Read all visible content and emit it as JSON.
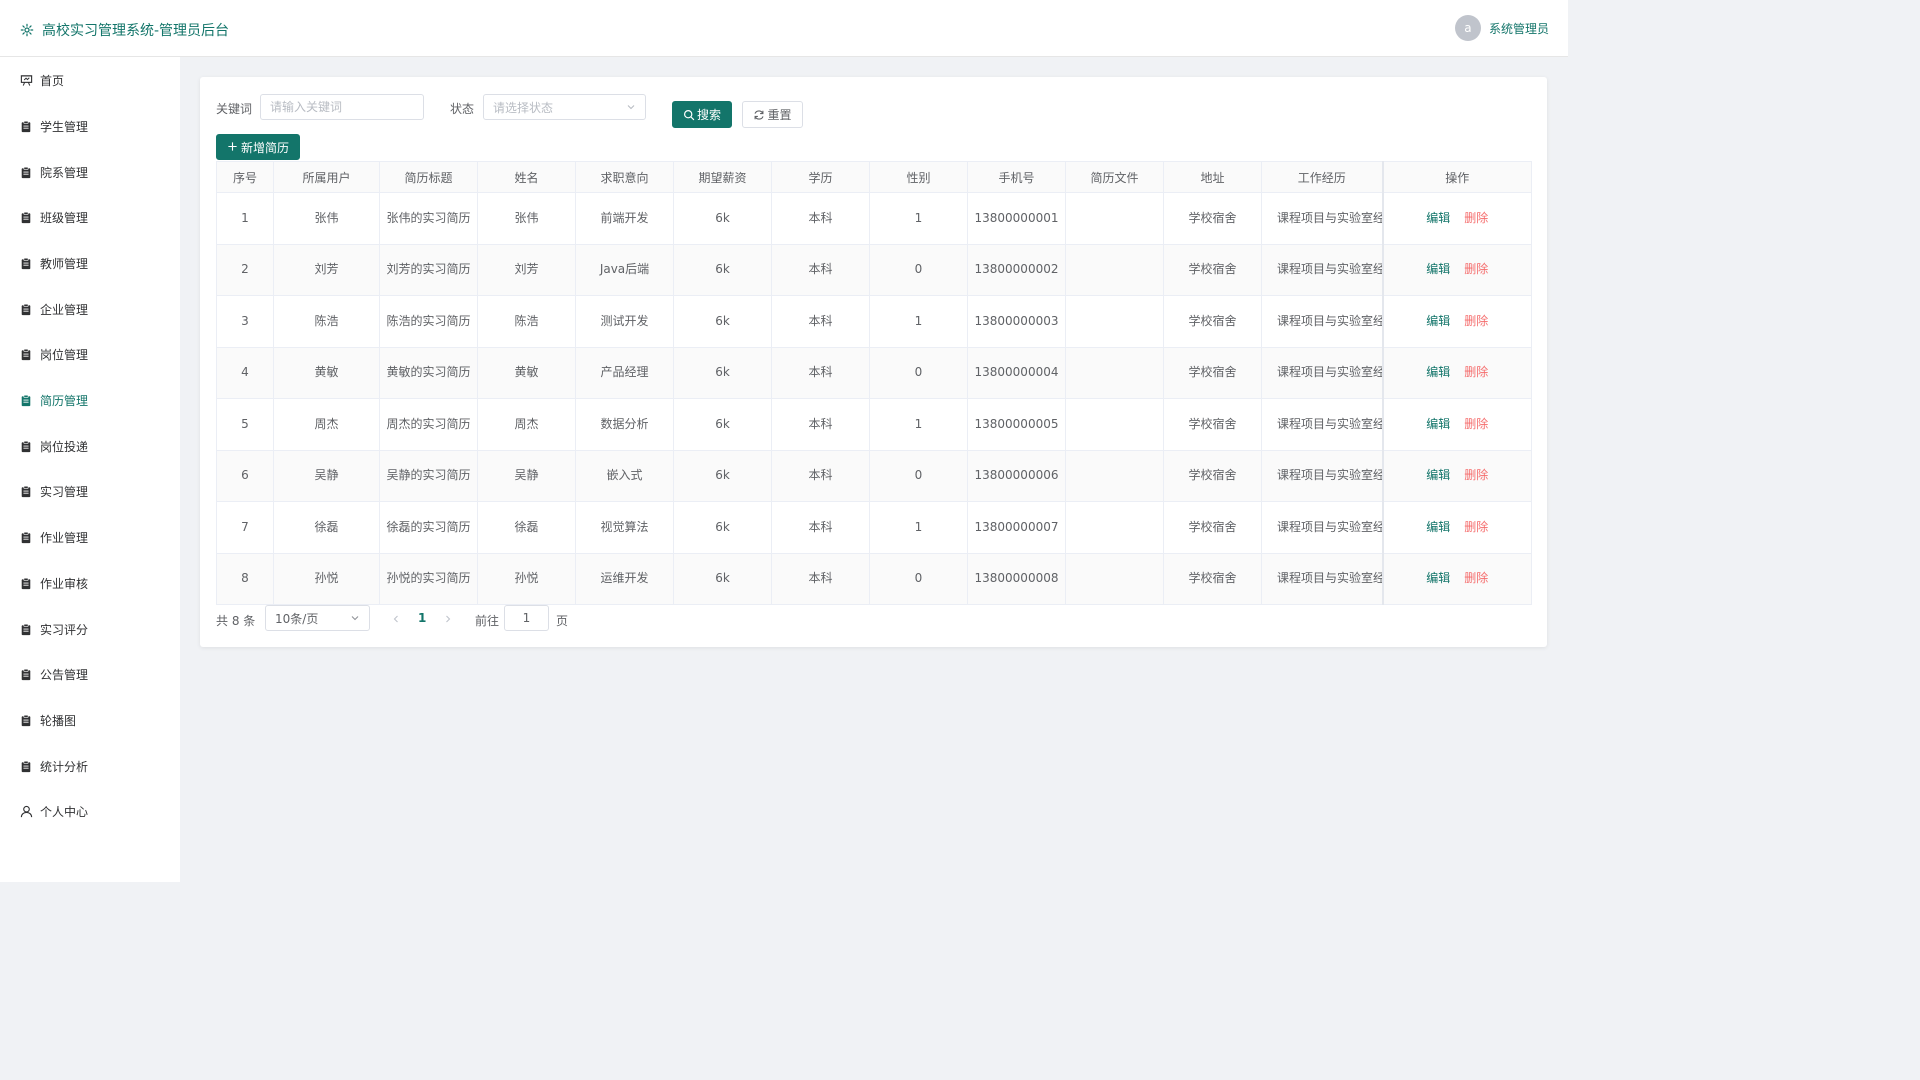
{
  "header": {
    "title": "高校实习管理系统-管理员后台",
    "avatar_letter": "a",
    "username": "系统管理员"
  },
  "sidebar": {
    "items": [
      {
        "label": "首页",
        "icon": "home-icon"
      },
      {
        "label": "学生管理",
        "icon": "clipboard-icon"
      },
      {
        "label": "院系管理",
        "icon": "clipboard-icon"
      },
      {
        "label": "班级管理",
        "icon": "clipboard-icon"
      },
      {
        "label": "教师管理",
        "icon": "clipboard-icon"
      },
      {
        "label": "企业管理",
        "icon": "clipboard-icon"
      },
      {
        "label": "岗位管理",
        "icon": "clipboard-icon"
      },
      {
        "label": "简历管理",
        "icon": "clipboard-icon",
        "active": true
      },
      {
        "label": "岗位投递",
        "icon": "clipboard-icon"
      },
      {
        "label": "实习管理",
        "icon": "clipboard-icon"
      },
      {
        "label": "作业管理",
        "icon": "clipboard-icon"
      },
      {
        "label": "作业审核",
        "icon": "clipboard-icon"
      },
      {
        "label": "实习评分",
        "icon": "clipboard-icon"
      },
      {
        "label": "公告管理",
        "icon": "clipboard-icon"
      },
      {
        "label": "轮播图",
        "icon": "clipboard-icon"
      },
      {
        "label": "统计分析",
        "icon": "clipboard-icon"
      },
      {
        "label": "个人中心",
        "icon": "user-icon"
      }
    ]
  },
  "filters": {
    "keyword_label": "关键词",
    "keyword_placeholder": "请输入关键词",
    "status_label": "状态",
    "status_placeholder": "请选择状态",
    "search_label": "搜索",
    "reset_label": "重置",
    "add_label": "新增简历"
  },
  "table": {
    "columns": [
      "序号",
      "所属用户",
      "简历标题",
      "姓名",
      "求职意向",
      "期望薪资",
      "学历",
      "性别",
      "手机号",
      "简历文件",
      "地址",
      "工作经历",
      "操作"
    ],
    "edit_label": "编辑",
    "delete_label": "删除",
    "rows": [
      {
        "no": "1",
        "user": "张伟",
        "title": "张伟的实习简历",
        "name": "张伟",
        "intent": "前端开发",
        "salary": "6k",
        "edu": "本科",
        "gender": "1",
        "phone": "13800000001",
        "file": "",
        "address": "学校宿舍",
        "experience": "课程项目与实验室经历"
      },
      {
        "no": "2",
        "user": "刘芳",
        "title": "刘芳的实习简历",
        "name": "刘芳",
        "intent": "Java后端",
        "salary": "6k",
        "edu": "本科",
        "gender": "0",
        "phone": "13800000002",
        "file": "",
        "address": "学校宿舍",
        "experience": "课程项目与实验室经历"
      },
      {
        "no": "3",
        "user": "陈浩",
        "title": "陈浩的实习简历",
        "name": "陈浩",
        "intent": "测试开发",
        "salary": "6k",
        "edu": "本科",
        "gender": "1",
        "phone": "13800000003",
        "file": "",
        "address": "学校宿舍",
        "experience": "课程项目与实验室经历"
      },
      {
        "no": "4",
        "user": "黄敏",
        "title": "黄敏的实习简历",
        "name": "黄敏",
        "intent": "产品经理",
        "salary": "6k",
        "edu": "本科",
        "gender": "0",
        "phone": "13800000004",
        "file": "",
        "address": "学校宿舍",
        "experience": "课程项目与实验室经历"
      },
      {
        "no": "5",
        "user": "周杰",
        "title": "周杰的实习简历",
        "name": "周杰",
        "intent": "数据分析",
        "salary": "6k",
        "edu": "本科",
        "gender": "1",
        "phone": "13800000005",
        "file": "",
        "address": "学校宿舍",
        "experience": "课程项目与实验室经历"
      },
      {
        "no": "6",
        "user": "吴静",
        "title": "吴静的实习简历",
        "name": "吴静",
        "intent": "嵌入式",
        "salary": "6k",
        "edu": "本科",
        "gender": "0",
        "phone": "13800000006",
        "file": "",
        "address": "学校宿舍",
        "experience": "课程项目与实验室经历"
      },
      {
        "no": "7",
        "user": "徐磊",
        "title": "徐磊的实习简历",
        "name": "徐磊",
        "intent": "视觉算法",
        "salary": "6k",
        "edu": "本科",
        "gender": "1",
        "phone": "13800000007",
        "file": "",
        "address": "学校宿舍",
        "experience": "课程项目与实验室经历"
      },
      {
        "no": "8",
        "user": "孙悦",
        "title": "孙悦的实习简历",
        "name": "孙悦",
        "intent": "运维开发",
        "salary": "6k",
        "edu": "本科",
        "gender": "0",
        "phone": "13800000008",
        "file": "",
        "address": "学校宿舍",
        "experience": "课程项目与实验室经历"
      }
    ]
  },
  "pagination": {
    "total": "共 8 条",
    "page_size": "10条/页",
    "current_page": "1",
    "goto_label": "前往",
    "goto_value": "1",
    "page_suffix": "页"
  },
  "colors": {
    "accent": "#13756a",
    "danger": "#f56c6c"
  }
}
